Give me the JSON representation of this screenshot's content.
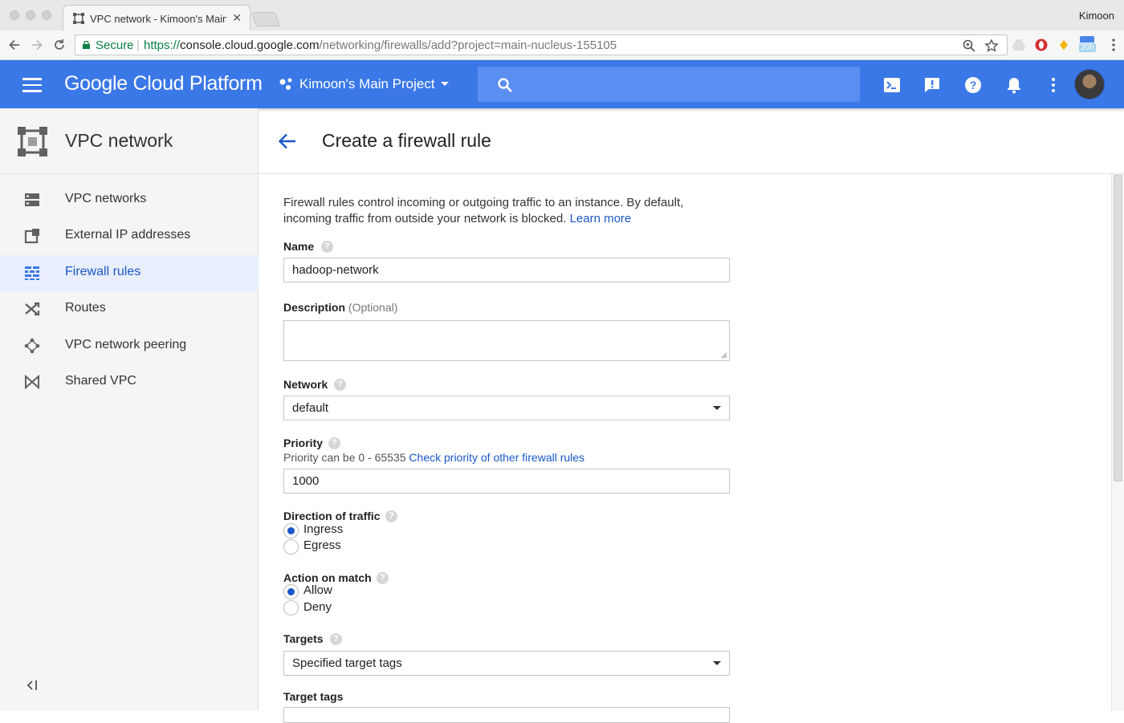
{
  "browser": {
    "tab_title": "VPC network - Kimoon's Main",
    "profile_name": "Kimoon",
    "secure_label": "Secure",
    "url_scheme": "https://",
    "url_host": "console.cloud.google.com",
    "url_path": "/networking/firewalls/add?project=main-nucleus-155105",
    "extension_badge": "20h"
  },
  "header": {
    "brand": "Google Cloud Platform",
    "project": "Kimoon's Main Project"
  },
  "sidebar": {
    "title": "VPC network",
    "items": [
      {
        "label": "VPC networks",
        "icon": "vpc-networks-icon",
        "active": false
      },
      {
        "label": "External IP addresses",
        "icon": "external-ip-icon",
        "active": false
      },
      {
        "label": "Firewall rules",
        "icon": "firewall-icon",
        "active": true
      },
      {
        "label": "Routes",
        "icon": "routes-icon",
        "active": false
      },
      {
        "label": "VPC network peering",
        "icon": "peering-icon",
        "active": false
      },
      {
        "label": "Shared VPC",
        "icon": "shared-vpc-icon",
        "active": false
      }
    ]
  },
  "page": {
    "title": "Create a firewall rule",
    "intro_line1": "Firewall rules control incoming or outgoing traffic to an instance. By default,",
    "intro_line2": "incoming traffic from outside your network is blocked.",
    "learn_more": "Learn more"
  },
  "form": {
    "name_label": "Name",
    "name_value": "hadoop-network",
    "description_label": "Description",
    "description_optional": "(Optional)",
    "description_value": "",
    "network_label": "Network",
    "network_value": "default",
    "priority_label": "Priority",
    "priority_hint": "Priority can be 0 - 65535",
    "priority_link": "Check priority of other firewall rules",
    "priority_value": "1000",
    "direction_label": "Direction of traffic",
    "direction_options": [
      "Ingress",
      "Egress"
    ],
    "direction_selected": "Ingress",
    "action_label": "Action on match",
    "action_options": [
      "Allow",
      "Deny"
    ],
    "action_selected": "Allow",
    "targets_label": "Targets",
    "targets_value": "Specified target tags",
    "target_tags_label": "Target tags"
  },
  "colors": {
    "header_blue": "#3b78e7",
    "link_blue": "#1a57c9",
    "secure_green": "#0b8043"
  }
}
